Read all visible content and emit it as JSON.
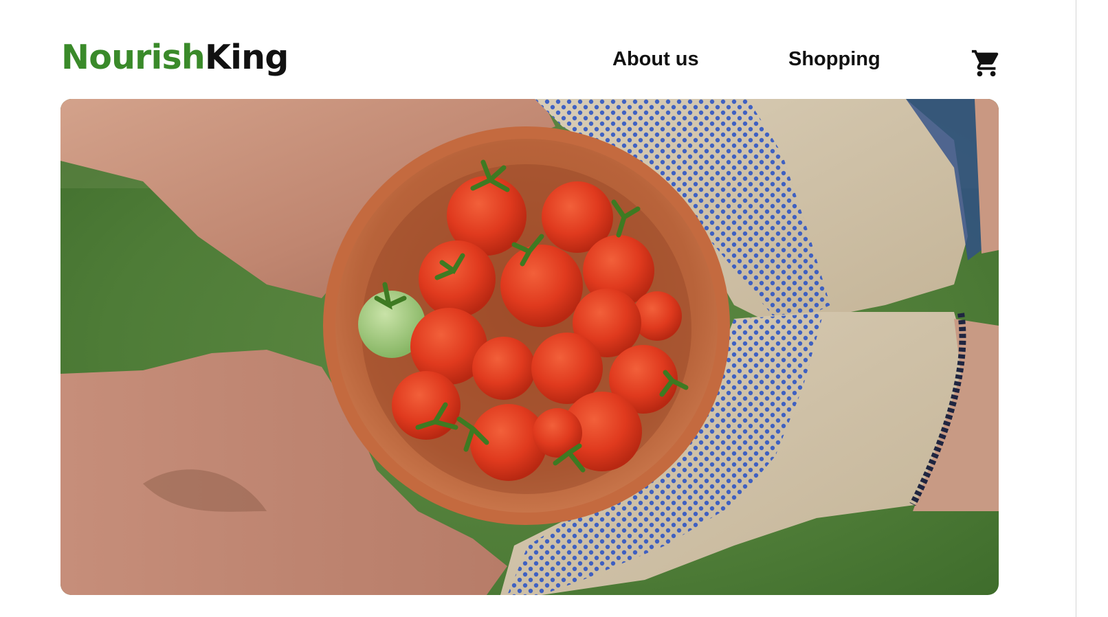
{
  "brand": {
    "accent": "Nourish",
    "rest": "King",
    "accent_color": "#3a8a2a"
  },
  "nav": {
    "about_label": "About us",
    "shopping_label": "Shopping"
  },
  "cart": {
    "icon": "shopping-cart-icon"
  },
  "hero": {
    "image": "hero-photo"
  }
}
